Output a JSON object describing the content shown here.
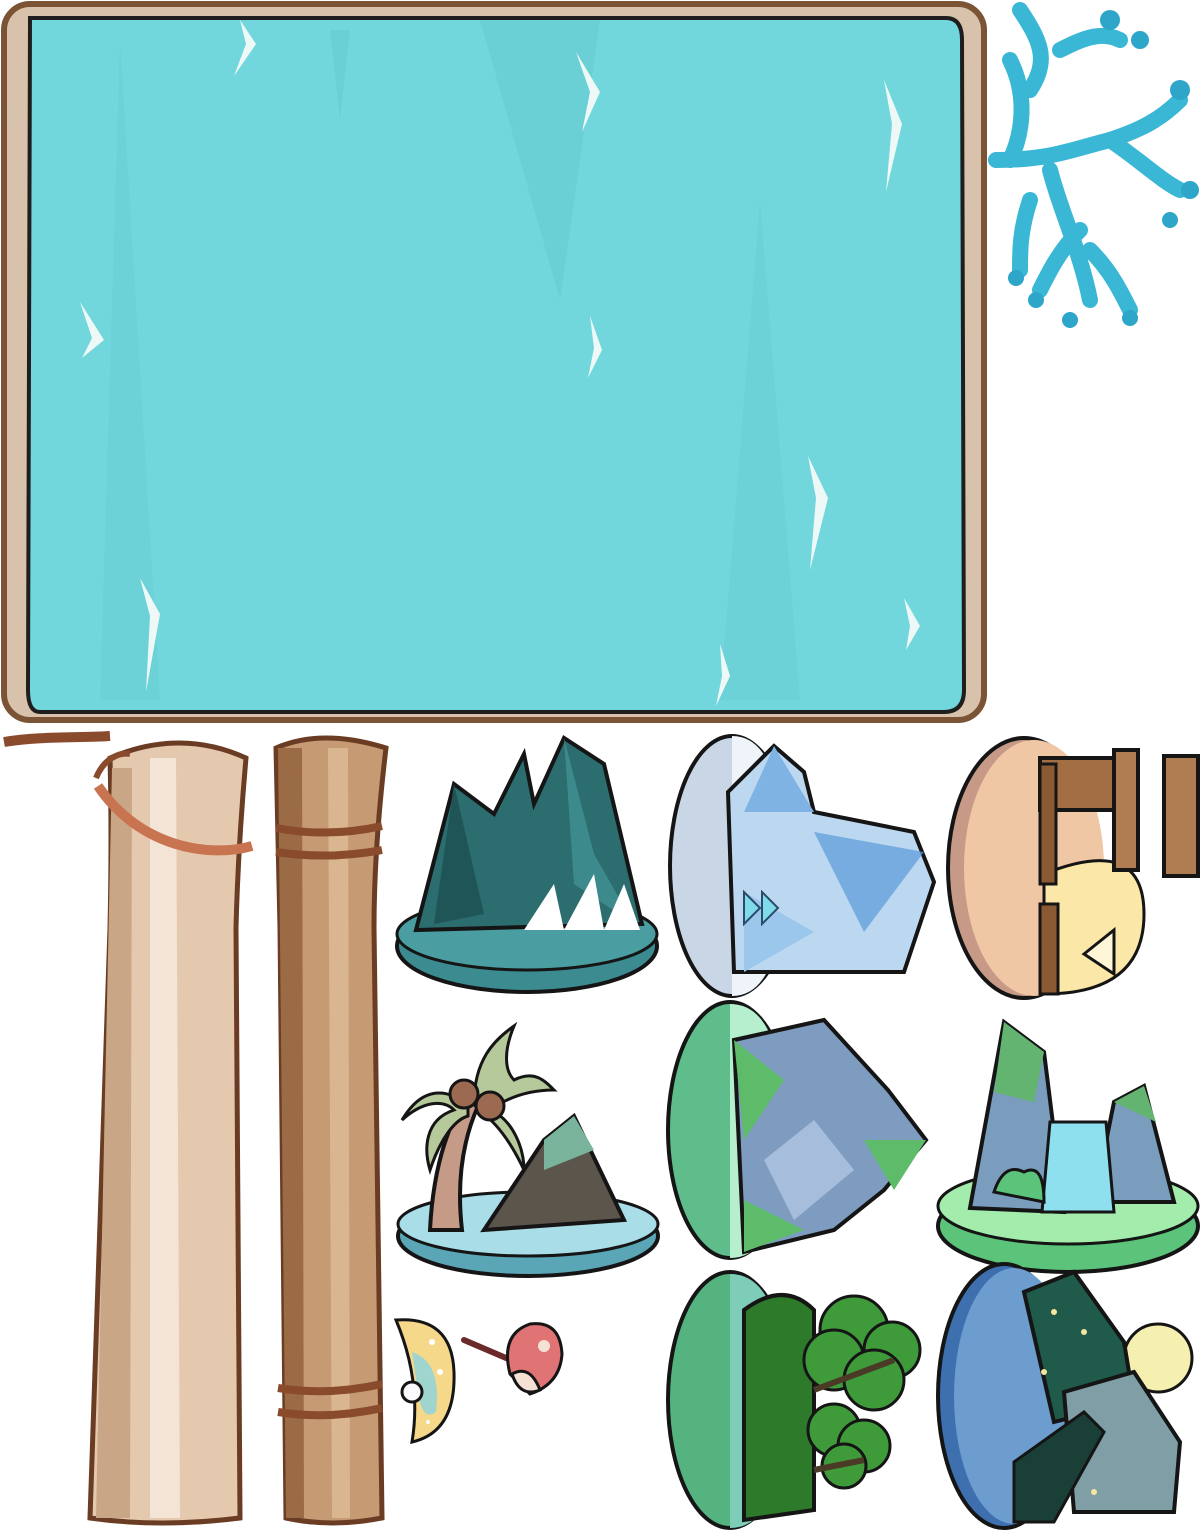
{
  "sprite_sheet": {
    "background": "#ffffff",
    "map_panel": {
      "water_color": "#72d7dd",
      "frame_color": "#7a5434",
      "inner_border": "#d8bfa6"
    },
    "coral": {
      "color": "#3bb7d6"
    },
    "scroll_rods": {
      "wood_light": "#e4c9af",
      "wood_dark": "#9b6b45",
      "rope_color": "#c97450"
    },
    "islands": [
      {
        "name": "dark-mountain",
        "rim": "#4a9da0"
      },
      {
        "name": "ice-peak",
        "rim": "#c9d6e6"
      },
      {
        "name": "desert-ruins",
        "rim": "#c69a86"
      },
      {
        "name": "palm-island",
        "rim": "#a9dde7"
      },
      {
        "name": "green-crystal",
        "rim": "#5ebd8a"
      },
      {
        "name": "waterfall-cliff",
        "rim": "#79d88e"
      },
      {
        "name": "forest-trees",
        "rim": "#6bc79c"
      },
      {
        "name": "night-rock",
        "rim": "#4a7cb8"
      }
    ],
    "small_items": [
      {
        "name": "shell-pearl"
      },
      {
        "name": "mushroom-pin"
      }
    ]
  }
}
